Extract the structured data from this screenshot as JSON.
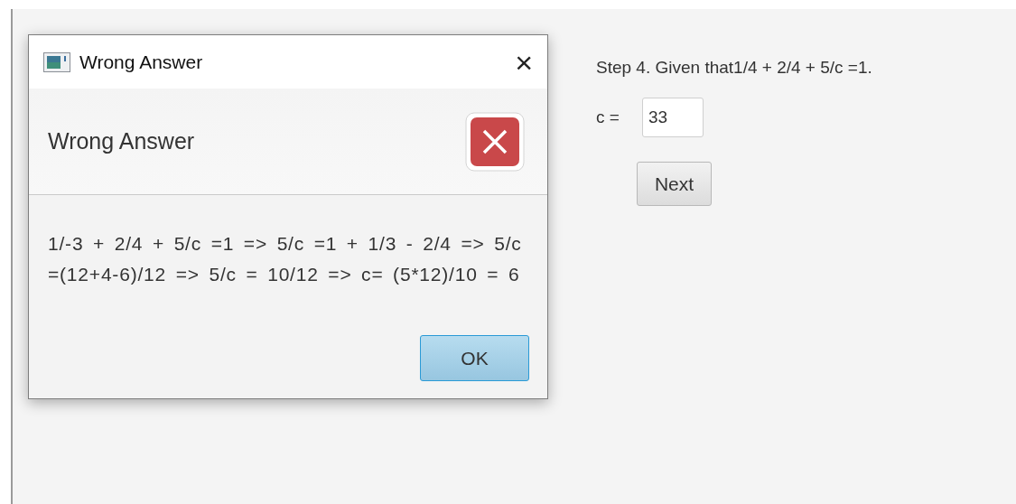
{
  "step": {
    "question": "Step 4. Given that1/4 + 2/4 + 5/c =1.",
    "field_label": "c =",
    "field_value": "33",
    "button": {
      "label": "Next",
      "default": false
    }
  },
  "dialog": {
    "title": "Wrong Answer",
    "close": "×",
    "header": "Wrong Answer",
    "error_icon": true,
    "message": "1/-3 + 2/4 + 5/c =1 => 5/c =1 + 1/3 - 2/4 => 5/c =(12+4-6)/12 => 5/c = 10/12 => c= (5*12)/10 = 6",
    "button": {
      "label": "OK",
      "default": true
    }
  }
}
